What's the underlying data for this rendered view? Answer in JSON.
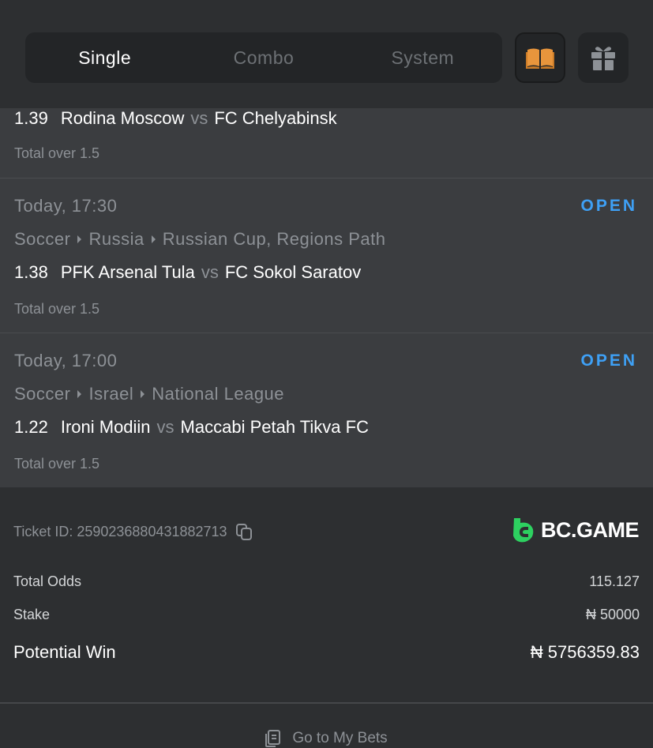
{
  "tabs": [
    {
      "label": "Single",
      "active": true
    },
    {
      "label": "Combo",
      "active": false
    },
    {
      "label": "System",
      "active": false
    }
  ],
  "toolbar": {
    "rules_icon": "book-icon",
    "gift_icon": "gift-icon"
  },
  "legs": [
    {
      "odds": "1.39",
      "home": "Rodina Moscow",
      "vs": "vs",
      "away": "FC Chelyabinsk",
      "market": "Total over 1.5"
    },
    {
      "time": "Today, 17:30",
      "status": "OPEN",
      "sport": "Soccer",
      "country": "Russia",
      "league": "Russian Cup, Regions Path",
      "odds": "1.38",
      "home": "PFK Arsenal Tula",
      "vs": "vs",
      "away": "FC Sokol Saratov",
      "market": "Total over 1.5"
    },
    {
      "time": "Today, 17:00",
      "status": "OPEN",
      "sport": "Soccer",
      "country": "Israel",
      "league": "National League",
      "odds": "1.22",
      "home": "Ironi Modiin",
      "vs": "vs",
      "away": "Maccabi Petah Tikva FC",
      "market": "Total over 1.5"
    }
  ],
  "ticket": {
    "id_label": "Ticket ID: 2590236880431882713",
    "brand": "BC.GAME",
    "total_odds_label": "Total Odds",
    "total_odds_value": "115.127",
    "stake_label": "Stake",
    "stake_value": "₦ 50000",
    "potential_win_label": "Potential Win",
    "potential_win_value": "₦ 5756359.83"
  },
  "footer": {
    "link_label": "Go to My Bets"
  },
  "colors": {
    "accent_open": "#3ea0f5",
    "brand_green": "#2dd160",
    "book_orange": "#e8953c",
    "card_bg": "#3b3d40",
    "page_bg": "#2d2f31"
  }
}
